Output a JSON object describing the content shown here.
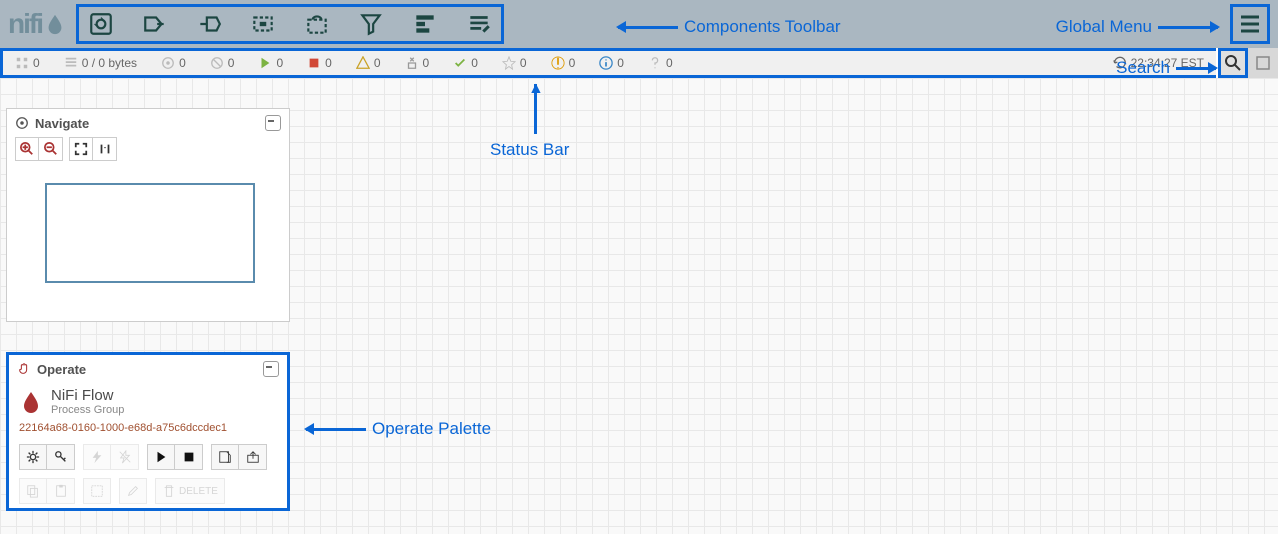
{
  "header": {
    "logo": "nifi",
    "annotations": {
      "components_toolbar": "Components Toolbar",
      "global_menu": "Global Menu"
    }
  },
  "status": {
    "active_threads": "0",
    "queued": "0 / 0 bytes",
    "transmitting": "0",
    "not_transmitting": "0",
    "running": "0",
    "stopped": "0",
    "invalid": "0",
    "disabled": "0",
    "uptodate": "0",
    "stale": "0",
    "sync_fail": "0",
    "info": "0",
    "unknown": "0",
    "refresh_time": "22:34:27 EST",
    "annotations": {
      "status_bar": "Status Bar",
      "search": "Search"
    }
  },
  "navigate": {
    "title": "Navigate"
  },
  "operate": {
    "title": "Operate",
    "flow_name": "NiFi Flow",
    "flow_type": "Process Group",
    "flow_id": "22164a68-0160-1000-e68d-a75c6dccdec1",
    "delete_label": "DELETE",
    "annotation": "Operate Palette"
  }
}
